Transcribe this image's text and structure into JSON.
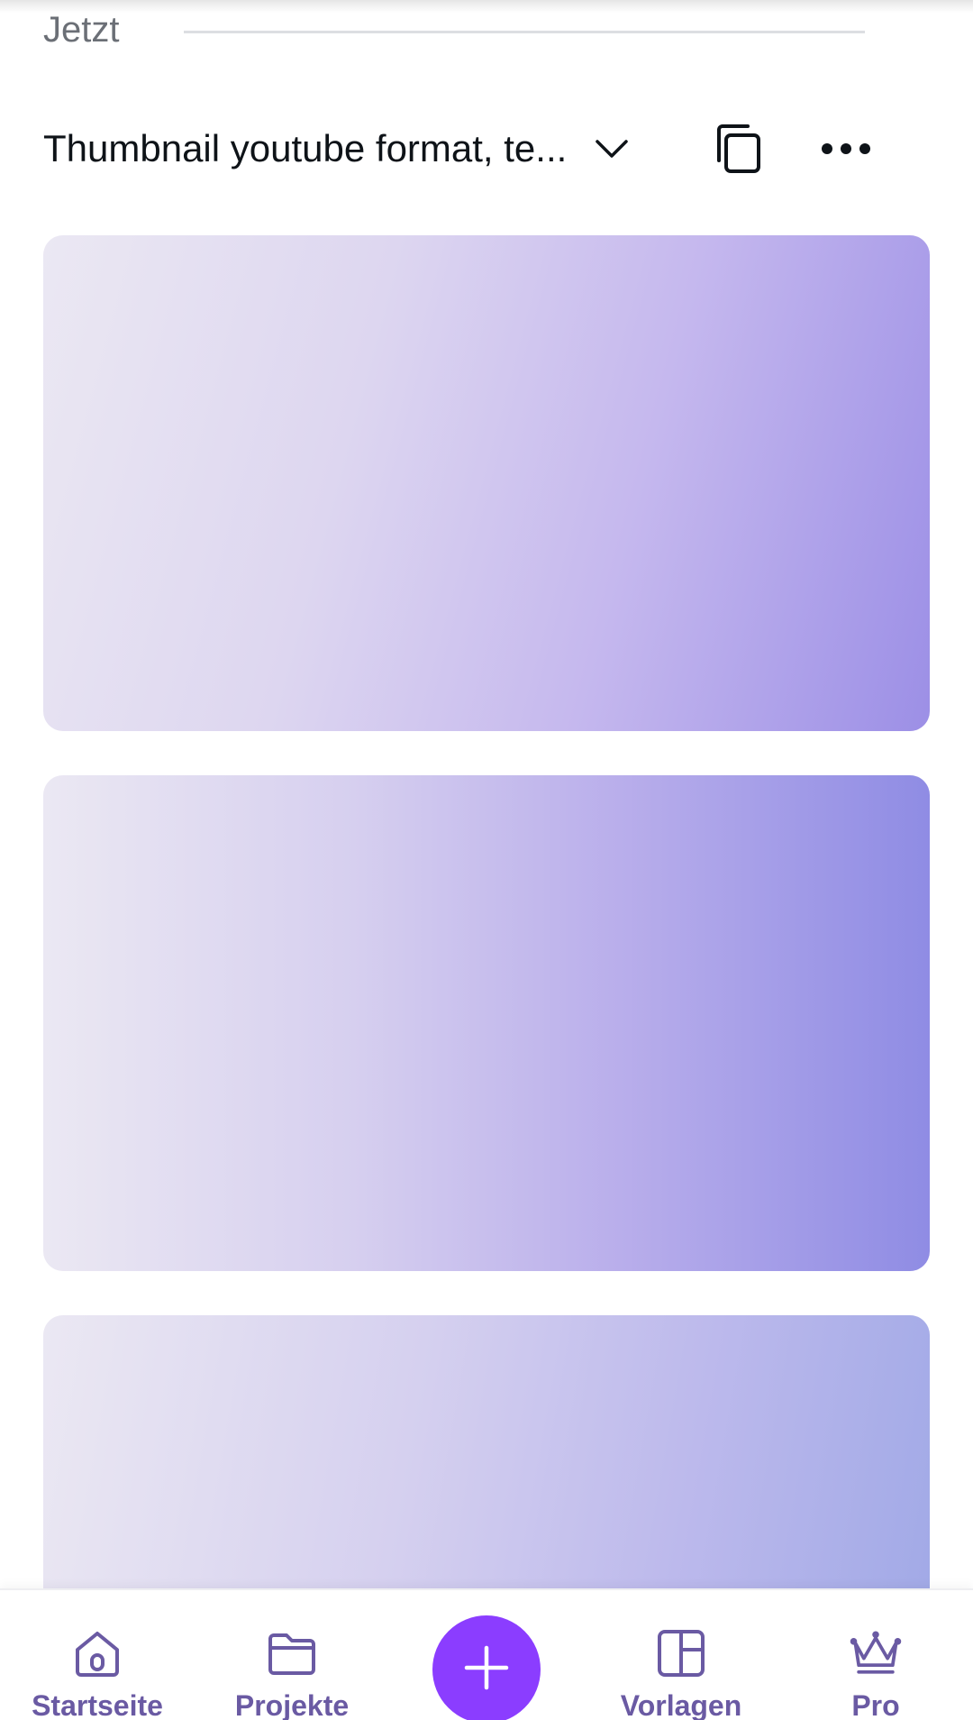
{
  "section": {
    "label": "Jetzt"
  },
  "design": {
    "title": "Thumbnail youtube format, te..."
  },
  "thumbnails": [
    {
      "colors": [
        "#ebe8f3",
        "#9c8fe6"
      ]
    },
    {
      "colors": [
        "#ebe8f3",
        "#8f8ce4"
      ]
    },
    {
      "colors": [
        "#ebe8f3",
        "#9fa8e6"
      ]
    }
  ],
  "nav": {
    "items": [
      {
        "label": "Startseite",
        "icon": "home-icon"
      },
      {
        "label": "Projekte",
        "icon": "folder-icon"
      },
      {
        "label": "Vorlagen",
        "icon": "templates-icon"
      },
      {
        "label": "Pro",
        "icon": "crown-icon"
      }
    ],
    "create_icon": "plus-icon"
  },
  "colors": {
    "accent": "#8b3dff",
    "nav_text": "#6a5aa3",
    "text": "#0e1318",
    "muted": "#6b6f76"
  }
}
